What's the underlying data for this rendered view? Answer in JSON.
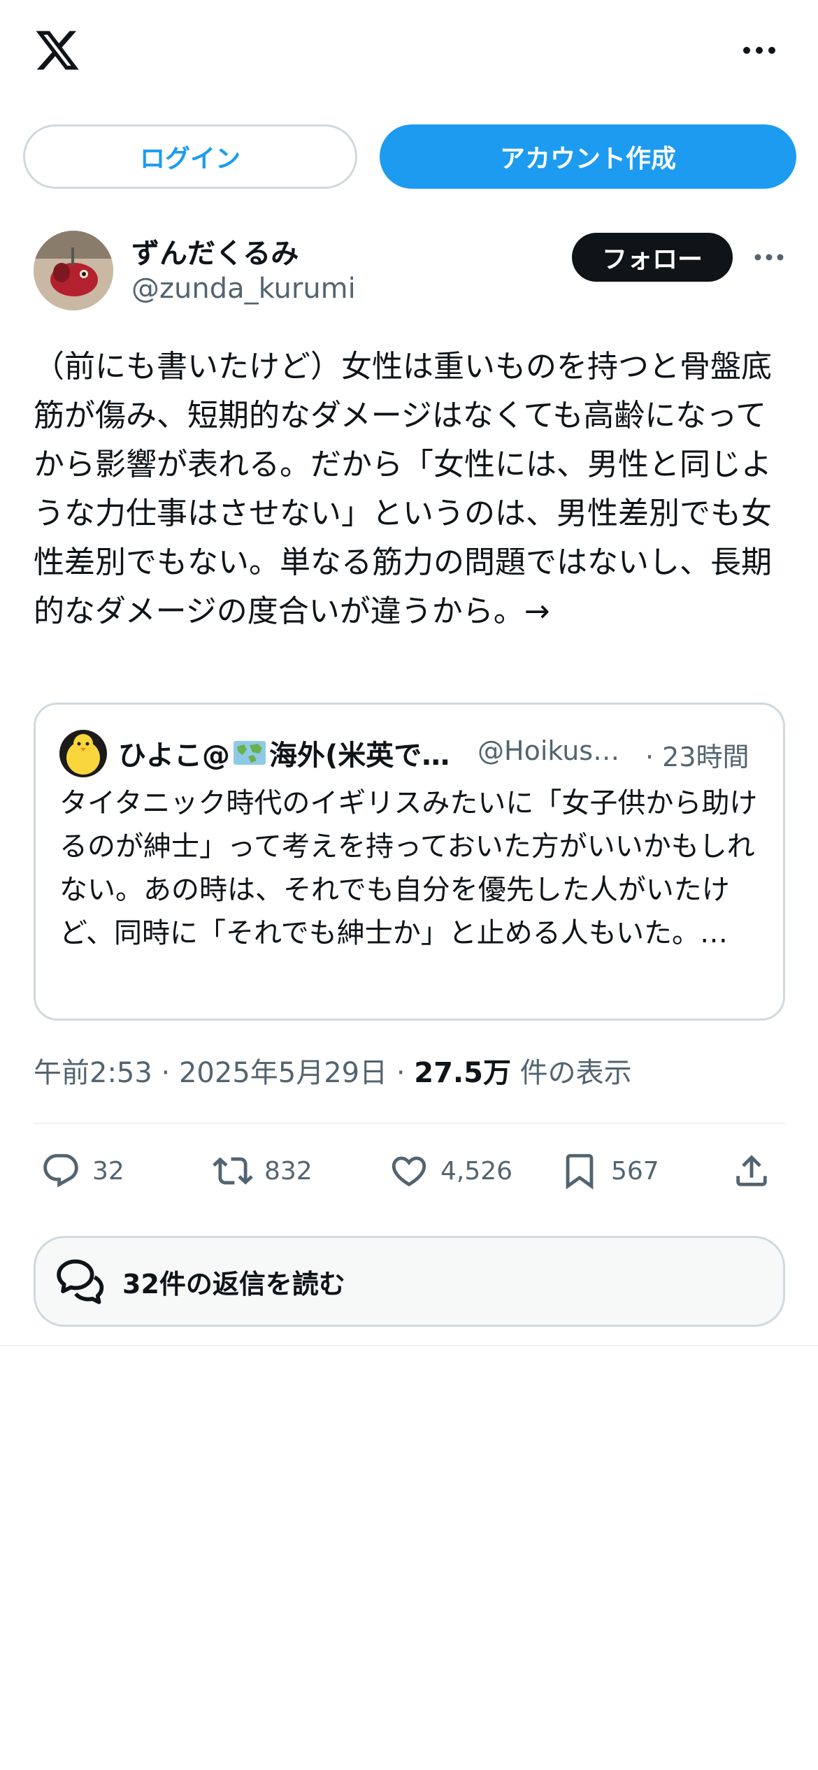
{
  "topbar": {
    "logo": "x-logo",
    "more": "more-icon"
  },
  "auth": {
    "login_label": "ログイン",
    "signup_label": "アカウント作成"
  },
  "author": {
    "name": "ずんだくるみ",
    "handle": "@zunda_kurumi",
    "follow_label": "フォロー"
  },
  "tweet": {
    "text": "（前にも書いたけど）女性は重いものを持つと骨盤底筋が傷み、短期的なダメージはなくても高齢になってから影響が表れる。だから「女性には、男性と同じような力仕事はさせない」というのは、男性差別でも女性差別でもない。単なる筋力の問題ではないし、長期的なダメージの度合いが違うから。→"
  },
  "quote": {
    "name_prefix": "ひよこ@",
    "name_suffix": "海外(米英で…",
    "handle": "@Hoikus…",
    "time": "· 23時間",
    "text": "タイタニック時代のイギリスみたいに「女子供から助けるのが紳士」って考えを持っておいた方がいいかもしれない。あの時は、それでも自分を優先した人がいたけど、同時に「それでも紳士か」と止める人もいた。…"
  },
  "meta": {
    "time_date": "午前2:53 · 2025年5月29日 · ",
    "views_count": "27.5万",
    "views_label": " 件の表示"
  },
  "actions": {
    "replies": "32",
    "reposts": "832",
    "likes": "4,526",
    "bookmarks": "567"
  },
  "read_replies_label": "32件の返信を読む",
  "colors": {
    "accent": "#1d9bf0",
    "text": "#0f1419",
    "muted": "#536471",
    "border": "#cfd9de"
  }
}
